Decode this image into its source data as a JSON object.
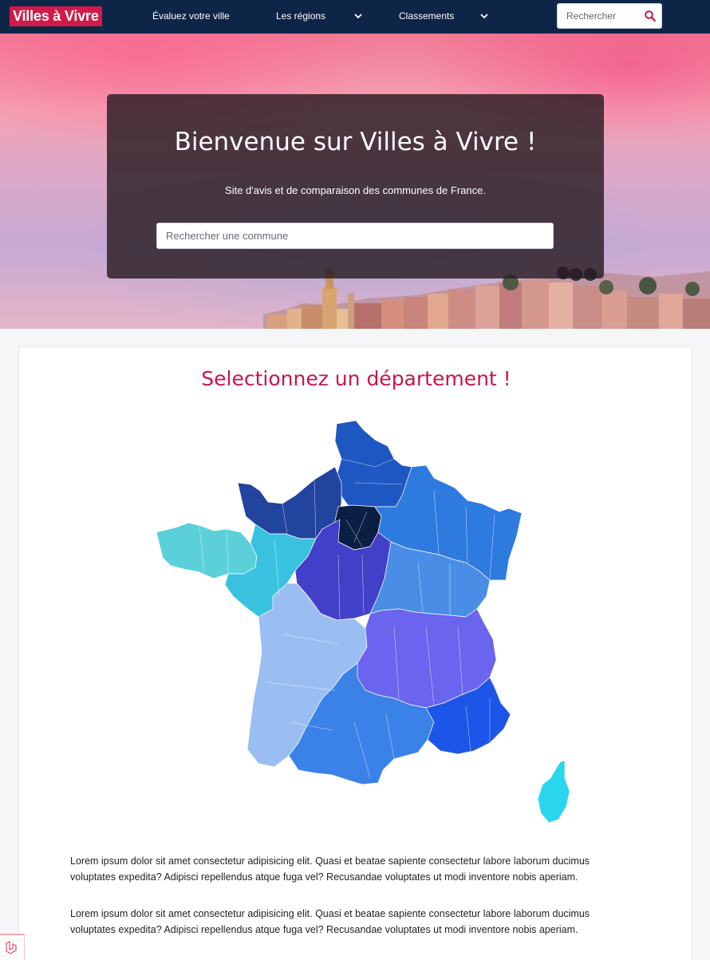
{
  "navbar": {
    "logo": "Villes à Vivre",
    "items": [
      {
        "label": "Évaluez votre ville"
      },
      {
        "label": "Les régions"
      },
      {
        "label": "Classements"
      }
    ],
    "search_placeholder": "Rechercher"
  },
  "hero": {
    "title": "Bienvenue sur Villes à Vivre !",
    "subtitle": "Site d'avis et de comparaison des communes de France.",
    "search_placeholder": "Rechercher une commune"
  },
  "main": {
    "title": "Selectionnez un département !",
    "paragraphs": [
      "Lorem ipsum dolor sit amet consectetur adipisicing elit. Quasi et beatae sapiente consectetur labore laborum ducimus voluptates expedita? Adipisci repellendus atque fuga vel? Recusandae voluptates ut modi inventore nobis aperiam.",
      "Lorem ipsum dolor sit amet consectetur adipisicing elit. Quasi et beatae sapiente consectetur labore laborum ducimus voluptates expedita? Adipisci repellendus atque fuga vel? Recusandae voluptates ut modi inventore nobis aperiam."
    ]
  },
  "colors": {
    "navbar_bg": "#0f2548",
    "brand": "#d11a48",
    "title_accent": "#c8164a",
    "regions": {
      "hauts_de_france": "#1f57c2",
      "normandie": "#23449e",
      "ile_de_france": "#0b1f45",
      "grand_est": "#2e7be0",
      "bretagne": "#5bd0d8",
      "pays_de_la_loire": "#38c2e0",
      "centre_val_de_loire": "#4240c8",
      "bourgogne_franche_comte": "#4a8de6",
      "nouvelle_aquitaine": "#9bbef2",
      "auvergne_rhone_alpes": "#6a64ee",
      "occitanie": "#3b82e8",
      "provence_alpes_cote_d_azur": "#1c55e8",
      "corse": "#2ad6ee"
    }
  },
  "icons": {
    "search": "search-icon",
    "chevron": "chevron-down-icon",
    "footer": "laravel-icon"
  }
}
